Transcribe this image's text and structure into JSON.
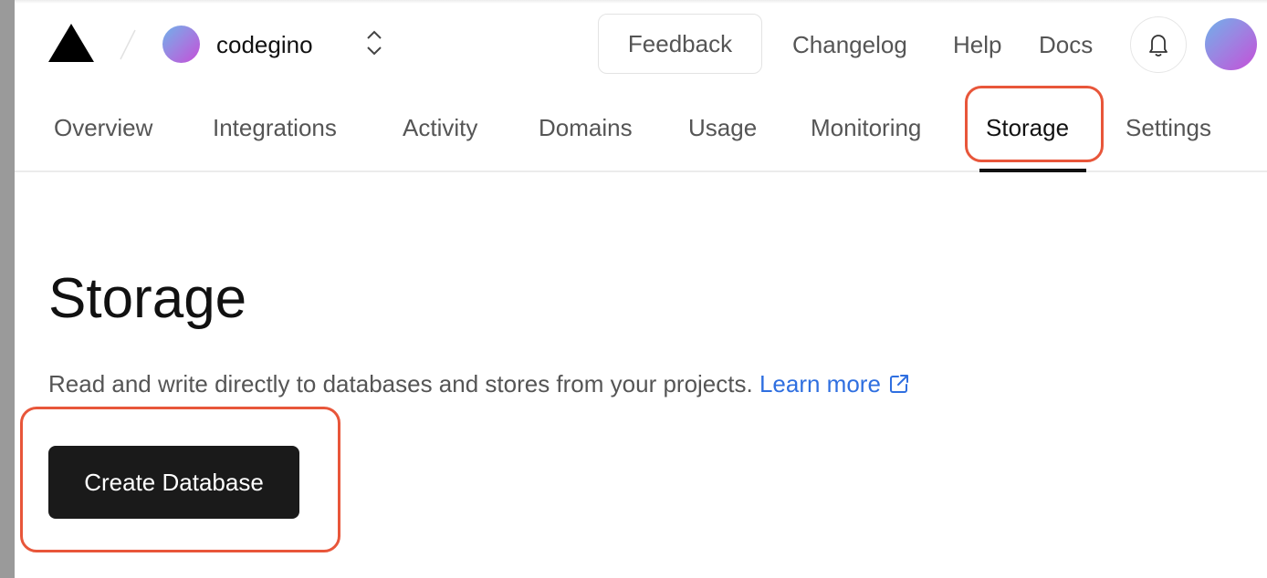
{
  "header": {
    "logo": "vercel-triangle-logo",
    "team_name": "codegino",
    "feedback_label": "Feedback",
    "links": [
      {
        "label": "Changelog"
      },
      {
        "label": "Help"
      },
      {
        "label": "Docs"
      }
    ],
    "notification_icon": "bell-icon",
    "avatar_gradient": [
      "#6fb1ea",
      "#c54fd8"
    ]
  },
  "tabs": [
    {
      "label": "Overview",
      "active": false
    },
    {
      "label": "Integrations",
      "active": false
    },
    {
      "label": "Activity",
      "active": false
    },
    {
      "label": "Domains",
      "active": false
    },
    {
      "label": "Usage",
      "active": false
    },
    {
      "label": "Monitoring",
      "active": false
    },
    {
      "label": "Storage",
      "active": true
    },
    {
      "label": "Settings",
      "active": false
    }
  ],
  "main": {
    "title": "Storage",
    "description": "Read and write directly to databases and stores from your projects.",
    "learn_more_label": "Learn more",
    "create_button_label": "Create Database"
  },
  "colors": {
    "highlight": "#e8563a",
    "link": "#2f6fe0",
    "primary_button": "#1a1a1a"
  }
}
